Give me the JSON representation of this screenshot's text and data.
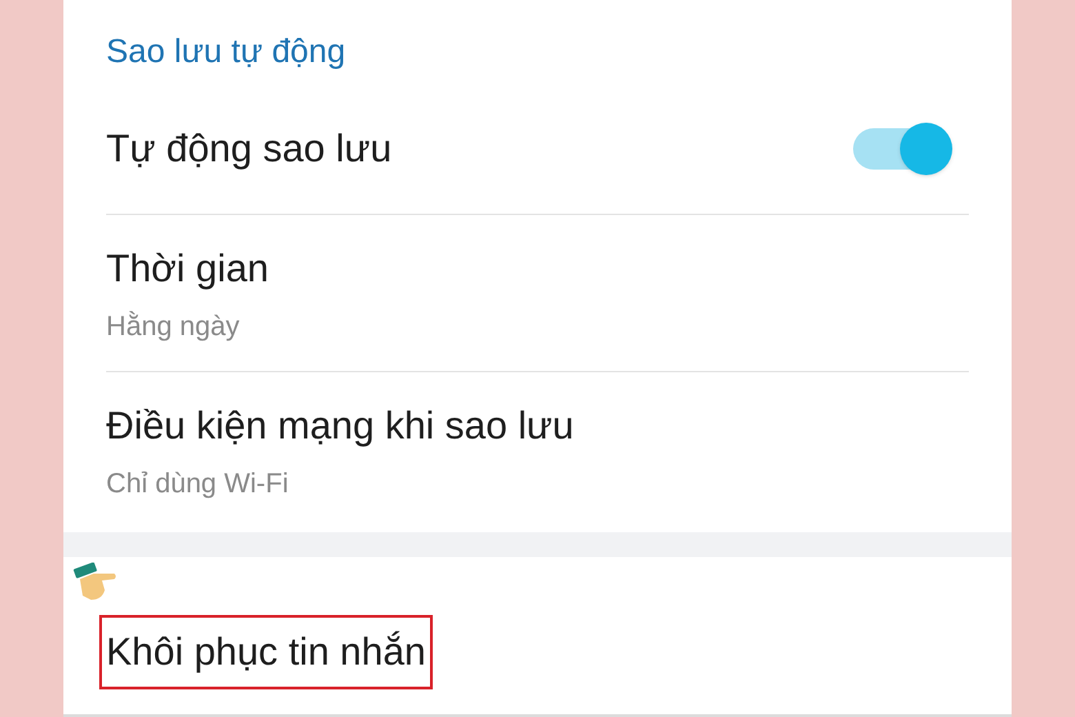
{
  "section_title": "Sao lưu tự động",
  "settings": [
    {
      "kind": "toggle",
      "label": "Tự động sao lưu",
      "on": true
    },
    {
      "kind": "detail",
      "label": "Thời gian",
      "value": "Hằng ngày"
    },
    {
      "kind": "detail",
      "label": "Điều kiện mạng khi sao lưu",
      "value": "Chỉ dùng Wi-Fi"
    }
  ],
  "restore": {
    "label": "Khôi phục tin nhắn",
    "highlighted": true
  }
}
